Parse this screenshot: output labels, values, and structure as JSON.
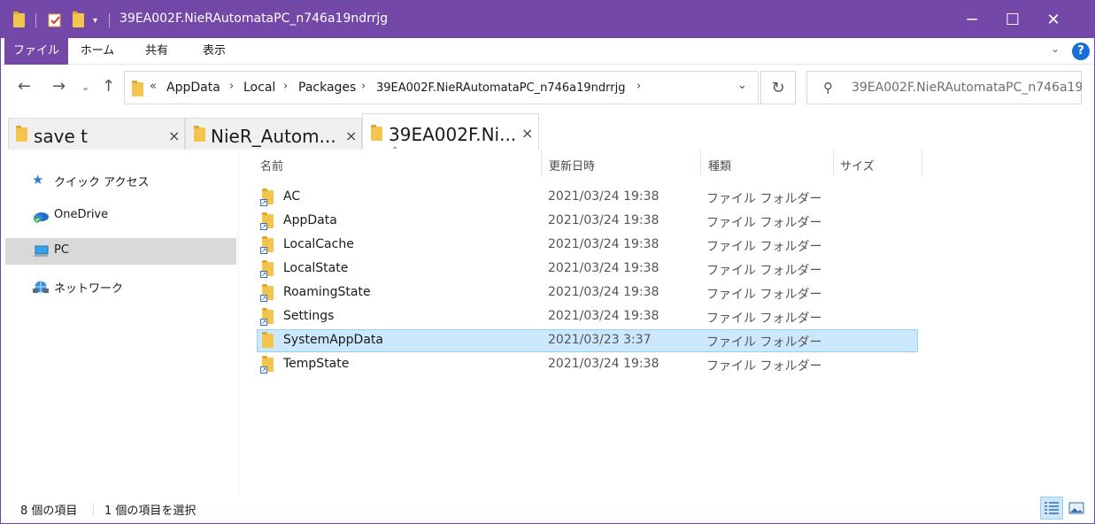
{
  "window": {
    "title": "39EA002F.NieRAutomataPC_n746a19ndrrjg",
    "controls": {
      "minimize": "─",
      "maximize": "☐",
      "close": "✕"
    }
  },
  "ribbon": {
    "tabs": [
      {
        "label": "ファイル",
        "active": true
      },
      {
        "label": "ホーム",
        "active": false
      },
      {
        "label": "共有",
        "active": false
      },
      {
        "label": "表示",
        "active": false
      }
    ],
    "help": "?"
  },
  "address": {
    "overflow": "«",
    "breadcrumbs": [
      "AppData",
      "Local",
      "Packages",
      "39EA002F.NieRAutomataPC_n746a19ndrrjg"
    ]
  },
  "search": {
    "text": "39EA002F.NieRAutomataPC_n746a19n..."
  },
  "tabs": [
    {
      "label": "save t",
      "active": false
    },
    {
      "label": "NieR_Autom...",
      "active": false
    },
    {
      "label": "39EA002F.Ni...",
      "active": true
    }
  ],
  "nav": [
    {
      "label": "クイック アクセス",
      "icon": "star-icon",
      "selected": false
    },
    {
      "label": "OneDrive",
      "icon": "cloud-icon",
      "selected": false
    },
    {
      "label": "PC",
      "icon": "pc-icon",
      "selected": true
    },
    {
      "label": "ネットワーク",
      "icon": "network-icon",
      "selected": false
    }
  ],
  "columns": [
    "名前",
    "更新日時",
    "種類",
    "サイズ"
  ],
  "files": [
    {
      "name": "AC",
      "date": "2021/03/24 19:38",
      "type": "ファイル フォルダー",
      "shortcut": true,
      "selected": false
    },
    {
      "name": "AppData",
      "date": "2021/03/24 19:38",
      "type": "ファイル フォルダー",
      "shortcut": true,
      "selected": false
    },
    {
      "name": "LocalCache",
      "date": "2021/03/24 19:38",
      "type": "ファイル フォルダー",
      "shortcut": true,
      "selected": false
    },
    {
      "name": "LocalState",
      "date": "2021/03/24 19:38",
      "type": "ファイル フォルダー",
      "shortcut": true,
      "selected": false
    },
    {
      "name": "RoamingState",
      "date": "2021/03/24 19:38",
      "type": "ファイル フォルダー",
      "shortcut": true,
      "selected": false
    },
    {
      "name": "Settings",
      "date": "2021/03/24 19:38",
      "type": "ファイル フォルダー",
      "shortcut": true,
      "selected": false
    },
    {
      "name": "SystemAppData",
      "date": "2021/03/23 3:37",
      "type": "ファイル フォルダー",
      "shortcut": false,
      "selected": true
    },
    {
      "name": "TempState",
      "date": "2021/03/24 19:38",
      "type": "ファイル フォルダー",
      "shortcut": true,
      "selected": false
    }
  ],
  "status": {
    "count": "8 個の項目",
    "selection": "1 個の項目を選択"
  },
  "colors": {
    "titlebar": "#7348a8",
    "selection": "#cce8ff",
    "folder": "#f3c54d"
  }
}
